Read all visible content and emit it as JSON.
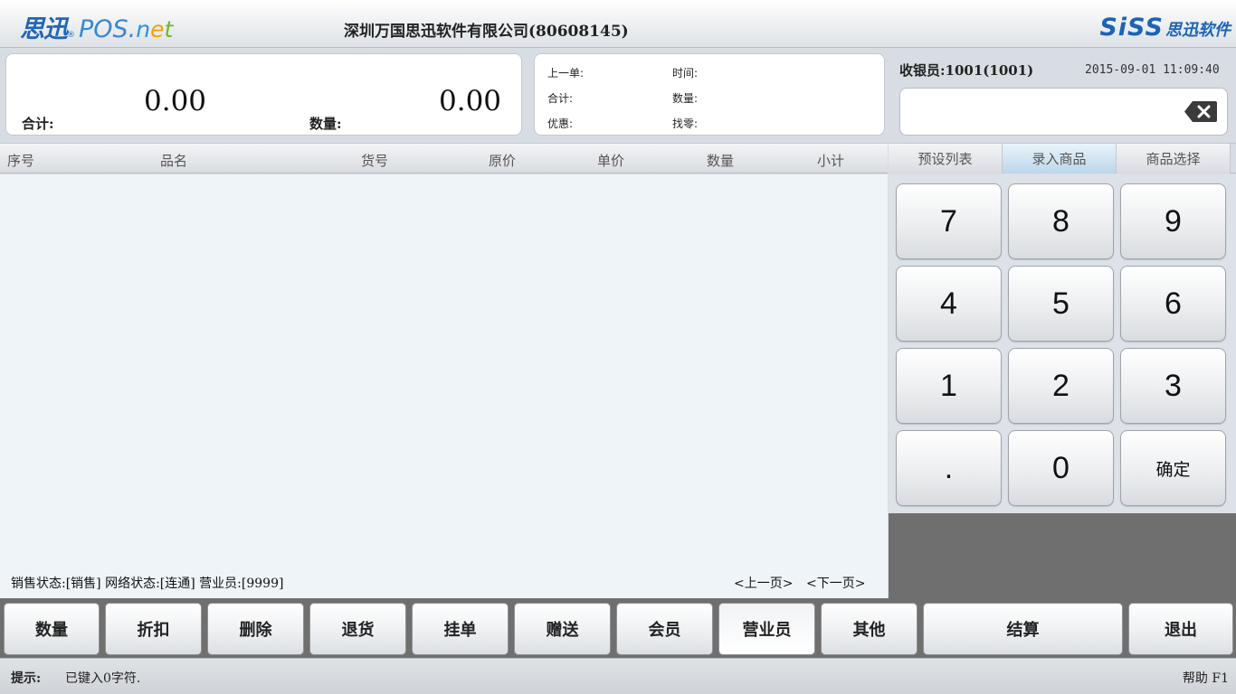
{
  "header": {
    "logo_cn": "思迅",
    "logo_reg": "®",
    "logo_pos": "POS.",
    "logo_net_n": "n",
    "logo_net_e": "e",
    "logo_net_t": "t",
    "company": "深圳万国思迅软件有限公司(80608145)",
    "brand_siss": "SiSS",
    "brand_cn": "思迅软件"
  },
  "totals": {
    "total_label": "合计:",
    "total_value": "0.00",
    "qty_label": "数量:",
    "qty_value": "0.00"
  },
  "last_order": {
    "prev_label": "上一单:",
    "time_label": "时间:",
    "total_label": "合计:",
    "qty_label": "数量:",
    "discount_label": "优惠:",
    "change_label": "找零:"
  },
  "cashier": {
    "label": "收银员:1001(1001)",
    "datetime": "2015-09-01 11:09:40"
  },
  "input": {
    "value": ""
  },
  "table": {
    "columns": [
      "序号",
      "品名",
      "货号",
      "原价",
      "单价",
      "数量",
      "小计"
    ],
    "rows": []
  },
  "status_bar": {
    "text": "销售状态:[销售] 网络状态:[连通] 营业员:[9999]",
    "prev_page": "<上一页>",
    "next_page": "<下一页>"
  },
  "tabs": [
    {
      "label": "预设列表"
    },
    {
      "label": "录入商品",
      "active": true
    },
    {
      "label": "商品选择"
    }
  ],
  "keypad": [
    "7",
    "8",
    "9",
    "4",
    "5",
    "6",
    "1",
    "2",
    "3",
    ".",
    "0",
    "确定"
  ],
  "toolbar": [
    {
      "label": "数量"
    },
    {
      "label": "折扣"
    },
    {
      "label": "删除"
    },
    {
      "label": "退货"
    },
    {
      "label": "挂单"
    },
    {
      "label": "赠送"
    },
    {
      "label": "会员"
    },
    {
      "label": "营业员",
      "active": true
    },
    {
      "label": "其他"
    },
    {
      "label": "结算"
    },
    {
      "label": "退出"
    }
  ],
  "footer": {
    "tip_label": "提示:",
    "tip_text": "已键入0字符.",
    "help": "帮助 F1"
  },
  "colors": {
    "brand_blue": "#1f66b7",
    "active_tab": "#bcd6ea",
    "toolbar_bg": "#6f6f6f"
  }
}
